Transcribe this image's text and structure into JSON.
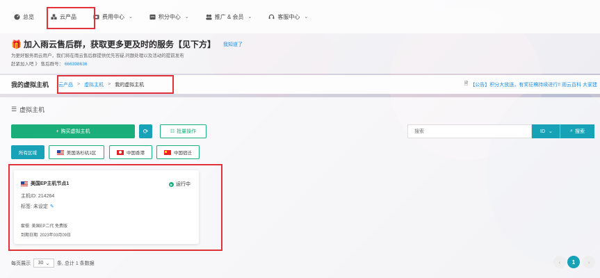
{
  "nav": {
    "items": [
      {
        "label": "总览",
        "icon": "dashboard-icon"
      },
      {
        "label": "云产品",
        "icon": "cloud-product-icon"
      },
      {
        "label": "费用中心",
        "icon": "billing-icon",
        "caret": "⌄"
      },
      {
        "label": "积分中心",
        "icon": "points-icon",
        "caret": "⌄"
      },
      {
        "label": "推广 & 会员",
        "icon": "members-icon",
        "caret": "⌄"
      },
      {
        "label": "客服中心",
        "icon": "support-icon",
        "caret": "⌄"
      }
    ]
  },
  "announce": {
    "title": "加入雨云售后群，获取更多更及时的服务【见下方】",
    "dismiss": "我知道了",
    "line1": "为更好服务雨云用户，我们将在雨云售后群提供优先答疑,问题处理以及活动的提前发布",
    "line2_prefix": "赶紧加入吧",
    "line2_mid": "》 售后群号：",
    "qq": "666398636"
  },
  "breadcrumb": {
    "title": "我的虚拟主机",
    "items": [
      "云产品",
      "虚拟主机",
      "我的虚拟主机"
    ],
    "sep": ">",
    "notice": "【公告】积分大放送，有奖征稿持续进行!! 雨云百科 大家建"
  },
  "panel": {
    "heading": "虚拟主机",
    "buy_label": "购买虚拟主机",
    "batch_label": "批量操作",
    "search_placeholder": "搜索",
    "search_field": "ID",
    "search_button": "搜索",
    "regions": [
      {
        "label": "所有区域",
        "flag": ""
      },
      {
        "label": "美国洛杉矶1区",
        "flag": "us"
      },
      {
        "label": "中国香港",
        "flag": "hk"
      },
      {
        "label": "中国宿迁",
        "flag": "cn"
      }
    ]
  },
  "card": {
    "name": "美国EP主机节点1",
    "status": "运行中",
    "host_id": "主机ID: 214264",
    "tag": "标签: 未设定",
    "plan": "套餐: 美国EP二代 免费版",
    "expires": "到期日期: 2023年03月09日"
  },
  "footer": {
    "prefix": "每页展示",
    "per_page": "30",
    "suffix": "条, 总计 1 条数据",
    "current_page": "1",
    "prev": "‹",
    "next": "›"
  },
  "colors": {
    "accent": "#1aae7a",
    "info": "#17a2b8",
    "link": "#1a8fe0",
    "highlight": "#e0313a"
  }
}
